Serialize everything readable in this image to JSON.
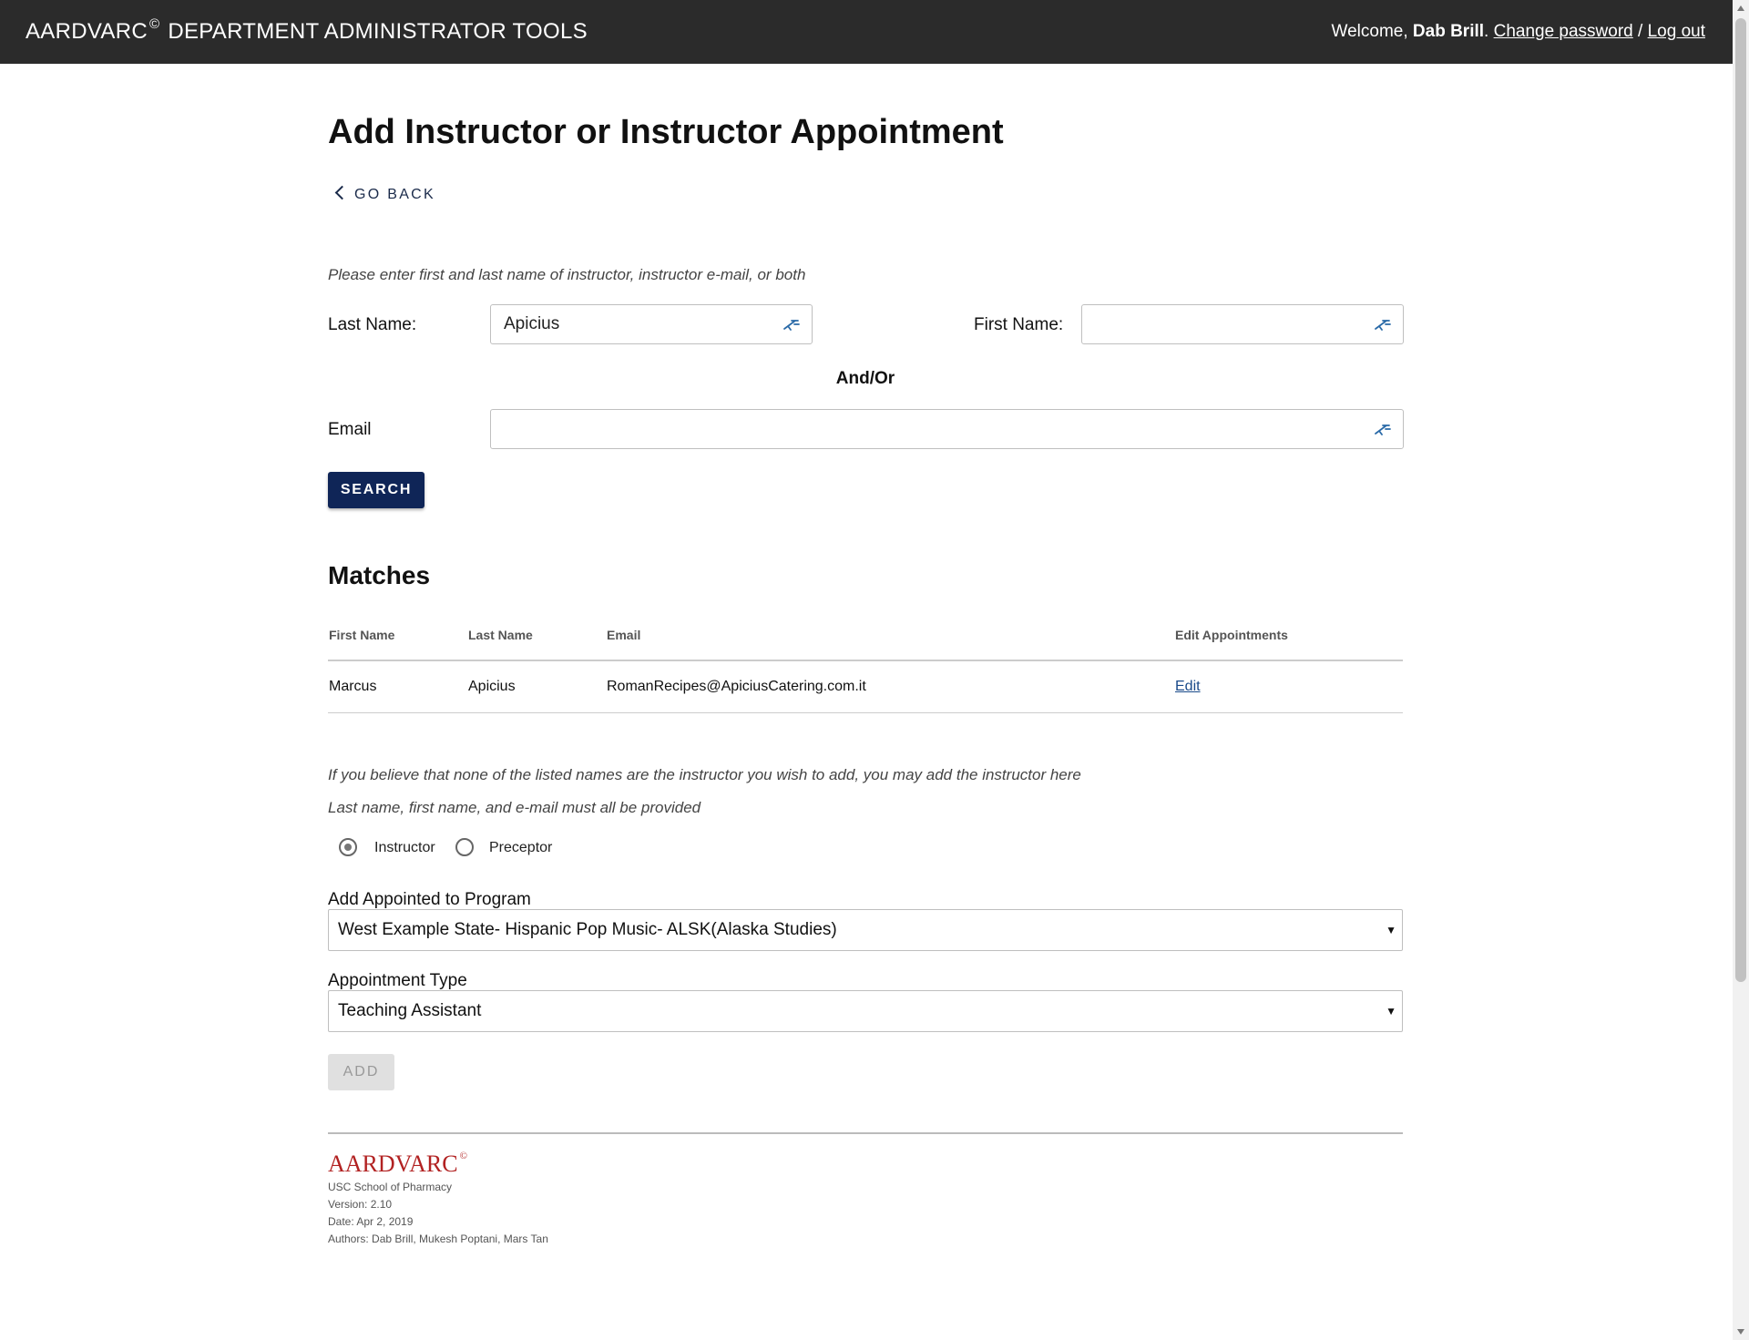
{
  "header": {
    "brand": "AARDVARC",
    "brand_symbol": "©",
    "title": "DEPARTMENT ADMINISTRATOR TOOLS",
    "welcome": "Welcome, ",
    "username": "Dab Brill",
    "period": ".",
    "change_password": "Change password",
    "separator": " / ",
    "logout": "Log out"
  },
  "page": {
    "title": "Add Instructor or Instructor Appointment",
    "go_back": "GO BACK"
  },
  "search": {
    "hint": "Please enter first and last name of instructor, instructor e-mail, or both",
    "last_name_label": "Last Name:",
    "last_name_value": "Apicius",
    "first_name_label": "First Name:",
    "first_name_value": "",
    "and_or": "And/Or",
    "email_label": "Email",
    "email_value": "",
    "button": "SEARCH"
  },
  "matches": {
    "title": "Matches",
    "columns": [
      "First Name",
      "Last Name",
      "Email",
      "Edit Appointments"
    ],
    "rows": [
      {
        "first": "Marcus",
        "last": "Apicius",
        "email": "RomanRecipes@ApiciusCatering.com.it",
        "action": "Edit"
      }
    ]
  },
  "add": {
    "note1": "If you believe that none of the listed names are the instructor you wish to add, you may add the instructor here",
    "note2": "Last name, first name, and e-mail must all be provided",
    "role_options": [
      "Instructor",
      "Preceptor"
    ],
    "role_selected": "Instructor",
    "program_label": "Add Appointed to Program",
    "program_value": "West Example State- Hispanic Pop Music- ALSK(Alaska Studies)",
    "type_label": "Appointment Type",
    "type_value": "Teaching Assistant",
    "button": "ADD"
  },
  "footer": {
    "logo": "AARDVARC",
    "logo_symbol": "©",
    "org": "USC School of Pharmacy",
    "version": "Version: 2.10",
    "date": "Date: Apr 2, 2019",
    "authors": "Authors: Dab Brill, Mukesh Poptani, Mars Tan"
  },
  "icons": {
    "input_fill": "autofill-key-icon",
    "back": "chevron-left-icon",
    "select_caret": "caret-down-icon"
  },
  "colors": {
    "topbar": "#2b2b2b",
    "primary": "#0f2557",
    "link": "#1a4a8a",
    "logo": "#b22222"
  }
}
